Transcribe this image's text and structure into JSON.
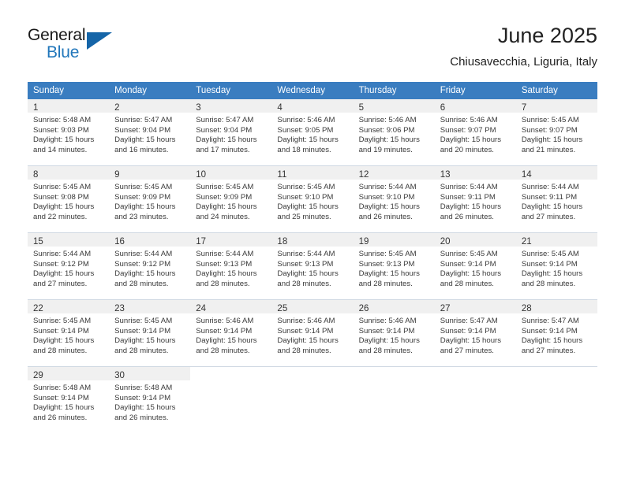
{
  "brand": {
    "word1": "General",
    "word2": "Blue",
    "triangle_color": "#1565a8",
    "blue_text_color": "#2277bb"
  },
  "header": {
    "title": "June 2025",
    "subtitle": "Chiusavecchia, Liguria, Italy"
  },
  "theme": {
    "header_row_bg": "#3a7dc0",
    "day_band_bg": "#f0f0f0",
    "row_rule": "#9ab3cc",
    "text": "#333333"
  },
  "weekday_headers": [
    "Sunday",
    "Monday",
    "Tuesday",
    "Wednesday",
    "Thursday",
    "Friday",
    "Saturday"
  ],
  "weeks": [
    [
      {
        "day": "1",
        "sunrise": "Sunrise: 5:48 AM",
        "sunset": "Sunset: 9:03 PM",
        "daylight1": "Daylight: 15 hours",
        "daylight2": "and 14 minutes."
      },
      {
        "day": "2",
        "sunrise": "Sunrise: 5:47 AM",
        "sunset": "Sunset: 9:04 PM",
        "daylight1": "Daylight: 15 hours",
        "daylight2": "and 16 minutes."
      },
      {
        "day": "3",
        "sunrise": "Sunrise: 5:47 AM",
        "sunset": "Sunset: 9:04 PM",
        "daylight1": "Daylight: 15 hours",
        "daylight2": "and 17 minutes."
      },
      {
        "day": "4",
        "sunrise": "Sunrise: 5:46 AM",
        "sunset": "Sunset: 9:05 PM",
        "daylight1": "Daylight: 15 hours",
        "daylight2": "and 18 minutes."
      },
      {
        "day": "5",
        "sunrise": "Sunrise: 5:46 AM",
        "sunset": "Sunset: 9:06 PM",
        "daylight1": "Daylight: 15 hours",
        "daylight2": "and 19 minutes."
      },
      {
        "day": "6",
        "sunrise": "Sunrise: 5:46 AM",
        "sunset": "Sunset: 9:07 PM",
        "daylight1": "Daylight: 15 hours",
        "daylight2": "and 20 minutes."
      },
      {
        "day": "7",
        "sunrise": "Sunrise: 5:45 AM",
        "sunset": "Sunset: 9:07 PM",
        "daylight1": "Daylight: 15 hours",
        "daylight2": "and 21 minutes."
      }
    ],
    [
      {
        "day": "8",
        "sunrise": "Sunrise: 5:45 AM",
        "sunset": "Sunset: 9:08 PM",
        "daylight1": "Daylight: 15 hours",
        "daylight2": "and 22 minutes."
      },
      {
        "day": "9",
        "sunrise": "Sunrise: 5:45 AM",
        "sunset": "Sunset: 9:09 PM",
        "daylight1": "Daylight: 15 hours",
        "daylight2": "and 23 minutes."
      },
      {
        "day": "10",
        "sunrise": "Sunrise: 5:45 AM",
        "sunset": "Sunset: 9:09 PM",
        "daylight1": "Daylight: 15 hours",
        "daylight2": "and 24 minutes."
      },
      {
        "day": "11",
        "sunrise": "Sunrise: 5:45 AM",
        "sunset": "Sunset: 9:10 PM",
        "daylight1": "Daylight: 15 hours",
        "daylight2": "and 25 minutes."
      },
      {
        "day": "12",
        "sunrise": "Sunrise: 5:44 AM",
        "sunset": "Sunset: 9:10 PM",
        "daylight1": "Daylight: 15 hours",
        "daylight2": "and 26 minutes."
      },
      {
        "day": "13",
        "sunrise": "Sunrise: 5:44 AM",
        "sunset": "Sunset: 9:11 PM",
        "daylight1": "Daylight: 15 hours",
        "daylight2": "and 26 minutes."
      },
      {
        "day": "14",
        "sunrise": "Sunrise: 5:44 AM",
        "sunset": "Sunset: 9:11 PM",
        "daylight1": "Daylight: 15 hours",
        "daylight2": "and 27 minutes."
      }
    ],
    [
      {
        "day": "15",
        "sunrise": "Sunrise: 5:44 AM",
        "sunset": "Sunset: 9:12 PM",
        "daylight1": "Daylight: 15 hours",
        "daylight2": "and 27 minutes."
      },
      {
        "day": "16",
        "sunrise": "Sunrise: 5:44 AM",
        "sunset": "Sunset: 9:12 PM",
        "daylight1": "Daylight: 15 hours",
        "daylight2": "and 28 minutes."
      },
      {
        "day": "17",
        "sunrise": "Sunrise: 5:44 AM",
        "sunset": "Sunset: 9:13 PM",
        "daylight1": "Daylight: 15 hours",
        "daylight2": "and 28 minutes."
      },
      {
        "day": "18",
        "sunrise": "Sunrise: 5:44 AM",
        "sunset": "Sunset: 9:13 PM",
        "daylight1": "Daylight: 15 hours",
        "daylight2": "and 28 minutes."
      },
      {
        "day": "19",
        "sunrise": "Sunrise: 5:45 AM",
        "sunset": "Sunset: 9:13 PM",
        "daylight1": "Daylight: 15 hours",
        "daylight2": "and 28 minutes."
      },
      {
        "day": "20",
        "sunrise": "Sunrise: 5:45 AM",
        "sunset": "Sunset: 9:14 PM",
        "daylight1": "Daylight: 15 hours",
        "daylight2": "and 28 minutes."
      },
      {
        "day": "21",
        "sunrise": "Sunrise: 5:45 AM",
        "sunset": "Sunset: 9:14 PM",
        "daylight1": "Daylight: 15 hours",
        "daylight2": "and 28 minutes."
      }
    ],
    [
      {
        "day": "22",
        "sunrise": "Sunrise: 5:45 AM",
        "sunset": "Sunset: 9:14 PM",
        "daylight1": "Daylight: 15 hours",
        "daylight2": "and 28 minutes."
      },
      {
        "day": "23",
        "sunrise": "Sunrise: 5:45 AM",
        "sunset": "Sunset: 9:14 PM",
        "daylight1": "Daylight: 15 hours",
        "daylight2": "and 28 minutes."
      },
      {
        "day": "24",
        "sunrise": "Sunrise: 5:46 AM",
        "sunset": "Sunset: 9:14 PM",
        "daylight1": "Daylight: 15 hours",
        "daylight2": "and 28 minutes."
      },
      {
        "day": "25",
        "sunrise": "Sunrise: 5:46 AM",
        "sunset": "Sunset: 9:14 PM",
        "daylight1": "Daylight: 15 hours",
        "daylight2": "and 28 minutes."
      },
      {
        "day": "26",
        "sunrise": "Sunrise: 5:46 AM",
        "sunset": "Sunset: 9:14 PM",
        "daylight1": "Daylight: 15 hours",
        "daylight2": "and 28 minutes."
      },
      {
        "day": "27",
        "sunrise": "Sunrise: 5:47 AM",
        "sunset": "Sunset: 9:14 PM",
        "daylight1": "Daylight: 15 hours",
        "daylight2": "and 27 minutes."
      },
      {
        "day": "28",
        "sunrise": "Sunrise: 5:47 AM",
        "sunset": "Sunset: 9:14 PM",
        "daylight1": "Daylight: 15 hours",
        "daylight2": "and 27 minutes."
      }
    ],
    [
      {
        "day": "29",
        "sunrise": "Sunrise: 5:48 AM",
        "sunset": "Sunset: 9:14 PM",
        "daylight1": "Daylight: 15 hours",
        "daylight2": "and 26 minutes."
      },
      {
        "day": "30",
        "sunrise": "Sunrise: 5:48 AM",
        "sunset": "Sunset: 9:14 PM",
        "daylight1": "Daylight: 15 hours",
        "daylight2": "and 26 minutes."
      },
      {
        "day": "",
        "sunrise": "",
        "sunset": "",
        "daylight1": "",
        "daylight2": ""
      },
      {
        "day": "",
        "sunrise": "",
        "sunset": "",
        "daylight1": "",
        "daylight2": ""
      },
      {
        "day": "",
        "sunrise": "",
        "sunset": "",
        "daylight1": "",
        "daylight2": ""
      },
      {
        "day": "",
        "sunrise": "",
        "sunset": "",
        "daylight1": "",
        "daylight2": ""
      },
      {
        "day": "",
        "sunrise": "",
        "sunset": "",
        "daylight1": "",
        "daylight2": ""
      }
    ]
  ]
}
